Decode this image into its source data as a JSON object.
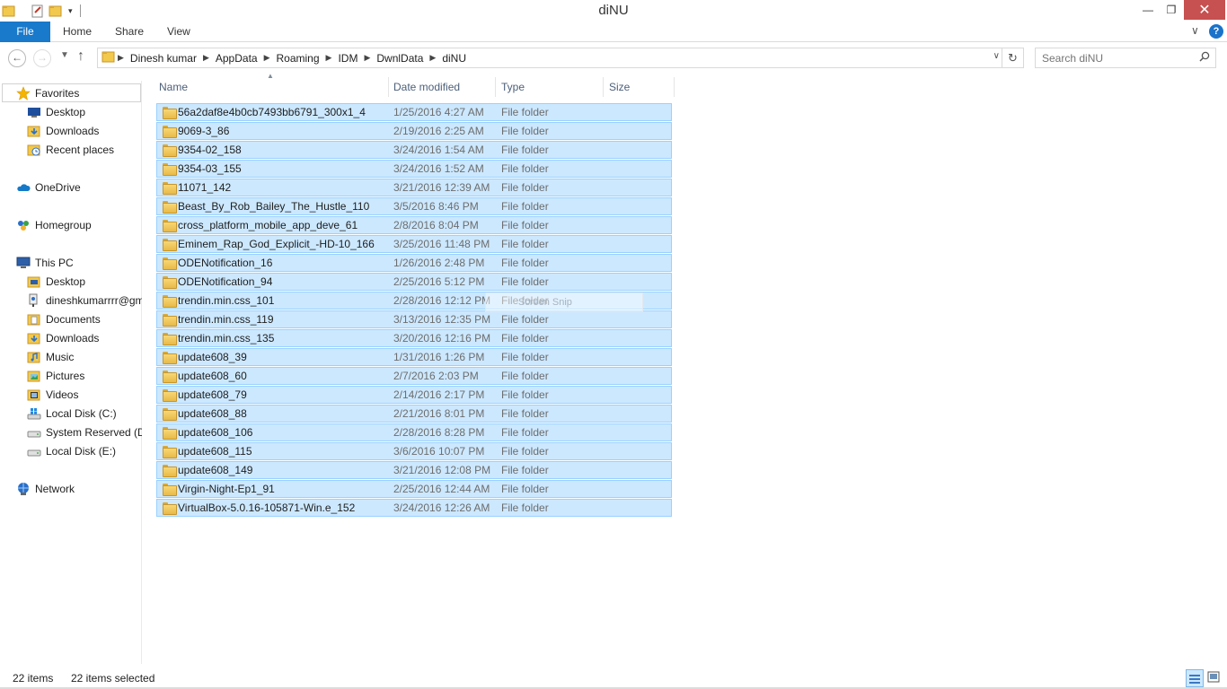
{
  "window": {
    "title": "diNU",
    "minimize_glyph": "—",
    "restore_glyph": "❐",
    "close_glyph": "✕"
  },
  "ribbon": {
    "tabs": [
      "File",
      "Home",
      "Share",
      "View"
    ],
    "expand_glyph": "∨",
    "help_glyph": "?"
  },
  "address": {
    "crumbs": [
      "Dinesh kumar",
      "AppData",
      "Roaming",
      "IDM",
      "DwnlData",
      "diNU"
    ]
  },
  "search": {
    "placeholder": "Search diNU"
  },
  "nav": {
    "favorites": "Favorites",
    "favorites_items": [
      "Desktop",
      "Downloads",
      "Recent places"
    ],
    "onedrive": "OneDrive",
    "homegroup": "Homegroup",
    "thispc": "This PC",
    "thispc_items": [
      "Desktop",
      "dineshkumarrrr@gm",
      "Documents",
      "Downloads",
      "Music",
      "Pictures",
      "Videos",
      "Local Disk (C:)",
      "System Reserved (D:",
      "Local Disk (E:)"
    ],
    "network": "Network"
  },
  "columns": {
    "name": "Name",
    "date": "Date modified",
    "type": "Type",
    "size": "Size"
  },
  "files": [
    {
      "name": "56a2daf8e4b0cb7493bb6791_300x1_4",
      "date": "1/25/2016 4:27 AM",
      "type": "File folder"
    },
    {
      "name": "9069-3_86",
      "date": "2/19/2016 2:25 AM",
      "type": "File folder"
    },
    {
      "name": "9354-02_158",
      "date": "3/24/2016 1:54 AM",
      "type": "File folder"
    },
    {
      "name": "9354-03_155",
      "date": "3/24/2016 1:52 AM",
      "type": "File folder"
    },
    {
      "name": "11071_142",
      "date": "3/21/2016 12:39 AM",
      "type": "File folder"
    },
    {
      "name": "Beast_By_Rob_Bailey_The_Hustle_110",
      "date": "3/5/2016 8:46 PM",
      "type": "File folder"
    },
    {
      "name": "cross_platform_mobile_app_deve_61",
      "date": "2/8/2016 8:04 PM",
      "type": "File folder"
    },
    {
      "name": "Eminem_Rap_God_Explicit_-HD-10_166",
      "date": "3/25/2016 11:48 PM",
      "type": "File folder"
    },
    {
      "name": "ODENotification_16",
      "date": "1/26/2016 2:48 PM",
      "type": "File folder"
    },
    {
      "name": "ODENotification_94",
      "date": "2/25/2016 5:12 PM",
      "type": "File folder"
    },
    {
      "name": "trendin.min.css_101",
      "date": "2/28/2016 12:12 PM",
      "type": "File folder"
    },
    {
      "name": "trendin.min.css_119",
      "date": "3/13/2016 12:35 PM",
      "type": "File folder"
    },
    {
      "name": "trendin.min.css_135",
      "date": "3/20/2016 12:16 PM",
      "type": "File folder"
    },
    {
      "name": "update608_39",
      "date": "1/31/2016 1:26 PM",
      "type": "File folder"
    },
    {
      "name": "update608_60",
      "date": "2/7/2016 2:03 PM",
      "type": "File folder"
    },
    {
      "name": "update608_79",
      "date": "2/14/2016 2:17 PM",
      "type": "File folder"
    },
    {
      "name": "update608_88",
      "date": "2/21/2016 8:01 PM",
      "type": "File folder"
    },
    {
      "name": "update608_106",
      "date": "2/28/2016 8:28 PM",
      "type": "File folder"
    },
    {
      "name": "update608_115",
      "date": "3/6/2016 10:07 PM",
      "type": "File folder"
    },
    {
      "name": "update608_149",
      "date": "3/21/2016 12:08 PM",
      "type": "File folder"
    },
    {
      "name": "Virgin-Night-Ep1_91",
      "date": "2/25/2016 12:44 AM",
      "type": "File folder"
    },
    {
      "name": "VirtualBox-5.0.16-105871-Win.e_152",
      "date": "3/24/2016 12:26 AM",
      "type": "File folder"
    }
  ],
  "ghost_text": "Screen Snip",
  "status": {
    "items": "22 items",
    "selected": "22 items selected"
  },
  "colors": {
    "accent": "#1979ca",
    "selection": "#cce8ff",
    "selection_border": "#99d1ff",
    "close": "#c75050"
  }
}
